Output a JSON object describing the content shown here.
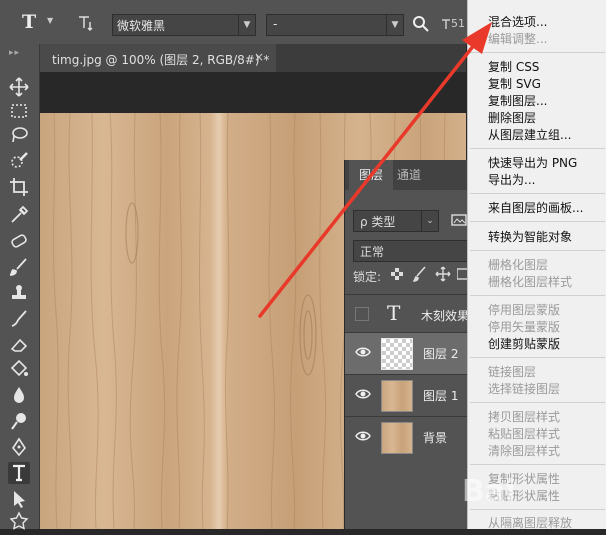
{
  "options_bar": {
    "tool_glyph": "T",
    "font_family": "微软雅黑",
    "font_style": "-",
    "size_partial": "51"
  },
  "document": {
    "tab_title": "timg.jpg @ 100% (图层 2, RGB/8#) *",
    "close": "×"
  },
  "layers_panel": {
    "tabs": [
      "图层",
      "通道"
    ],
    "filter_label": "ρ 类型",
    "blend_mode": "正常",
    "lock_label": "锁定:",
    "layers": [
      {
        "name": "木刻效果",
        "type": "text",
        "glyph": "T"
      },
      {
        "name": "图层 2",
        "type": "transparent",
        "selected": true
      },
      {
        "name": "图层 1",
        "type": "wood"
      },
      {
        "name": "背景",
        "type": "wood"
      }
    ]
  },
  "context_menu": {
    "items": [
      {
        "label": "混合选项...",
        "disabled": false
      },
      {
        "label": "编辑调整...",
        "disabled": true
      },
      {
        "label": "复制 CSS",
        "disabled": false
      },
      {
        "label": "复制 SVG",
        "disabled": false
      },
      {
        "label": "复制图层...",
        "disabled": false
      },
      {
        "label": "删除图层",
        "disabled": false
      },
      {
        "label": "从图层建立组...",
        "disabled": false
      },
      {
        "label": "快速导出为 PNG",
        "disabled": false
      },
      {
        "label": "导出为...",
        "disabled": false
      },
      {
        "label": "来自图层的画板...",
        "disabled": false
      },
      {
        "label": "转换为智能对象",
        "disabled": false
      },
      {
        "label": "栅格化图层",
        "disabled": true
      },
      {
        "label": "栅格化图层样式",
        "disabled": true
      },
      {
        "label": "停用图层蒙版",
        "disabled": true
      },
      {
        "label": "停用矢量蒙版",
        "disabled": true
      },
      {
        "label": "创建剪贴蒙版",
        "disabled": false
      },
      {
        "label": "链接图层",
        "disabled": true
      },
      {
        "label": "选择链接图层",
        "disabled": true
      },
      {
        "label": "拷贝图层样式",
        "disabled": true
      },
      {
        "label": "粘贴图层样式",
        "disabled": true
      },
      {
        "label": "清除图层样式",
        "disabled": true
      },
      {
        "label": "复制形状属性",
        "disabled": true
      },
      {
        "label": "粘贴形状属性",
        "disabled": true
      },
      {
        "label": "从隔离图层释放",
        "disabled": true
      }
    ]
  },
  "watermark": "Bai",
  "colors": {
    "arrow": "#e8392a",
    "panel": "#535353",
    "menu_bg": "#f0f0f0",
    "selected_layer": "#6c6c6c"
  }
}
